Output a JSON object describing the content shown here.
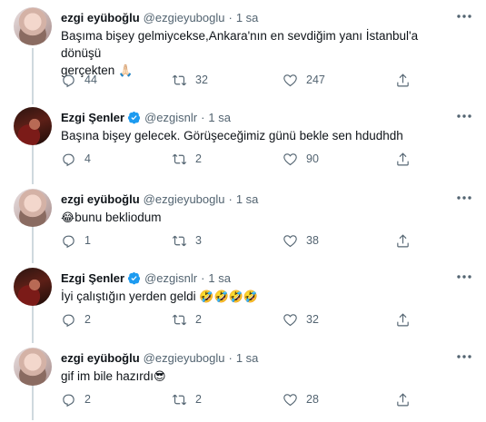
{
  "tweets": [
    {
      "name": "ezgi eyüboğlu",
      "handle": "@ezgieyuboglu",
      "separator": "·",
      "time": "1 sa",
      "verified": false,
      "avatar": "ezgi",
      "line1": "Başıma bişey gelmiycekse,Ankara'nın en sevdiğim yanı İstanbul'a dönüşü",
      "line2": "gerçekten",
      "emoji_after": "🙏🏻",
      "emoji_before": "",
      "replies": "44",
      "retweets": "32",
      "likes": "247"
    },
    {
      "name": "Ezgi Şenler",
      "handle": "@ezgisnlr",
      "separator": "·",
      "time": "1 sa",
      "verified": true,
      "avatar": "senler",
      "line1": "Başına bişey gelecek. Görüşeceğimiz günü bekle sen hdudhdh",
      "line2": "",
      "emoji_after": "",
      "emoji_before": "",
      "replies": "4",
      "retweets": "2",
      "likes": "90"
    },
    {
      "name": "ezgi eyüboğlu",
      "handle": "@ezgieyuboglu",
      "separator": "·",
      "time": "1 sa",
      "verified": false,
      "avatar": "ezgi",
      "line1": "bunu bekliodum",
      "line2": "",
      "emoji_after": "",
      "emoji_before": "😂",
      "replies": "1",
      "retweets": "3",
      "likes": "38"
    },
    {
      "name": "Ezgi Şenler",
      "handle": "@ezgisnlr",
      "separator": "·",
      "time": "1 sa",
      "verified": true,
      "avatar": "senler",
      "line1": "İyi çalıştığın yerden geldi",
      "line2": "",
      "emoji_after": "🤣🤣🤣🤣",
      "emoji_before": "",
      "replies": "2",
      "retweets": "2",
      "likes": "32"
    },
    {
      "name": "ezgi eyüboğlu",
      "handle": "@ezgieyuboglu",
      "separator": "·",
      "time": "1 sa",
      "verified": false,
      "avatar": "ezgi",
      "line1": "gif im bile hazırdı",
      "line2": "",
      "emoji_after": "😎",
      "emoji_before": "",
      "replies": "2",
      "retweets": "2",
      "likes": "28"
    }
  ],
  "icons": {
    "reply": "reply-icon",
    "retweet": "retweet-icon",
    "like": "like-icon",
    "share": "share-icon",
    "more": "more-icon",
    "verified": "verified-badge-icon"
  },
  "colors": {
    "text": "#0f1419",
    "secondary": "#536471",
    "verified": "#1d9bf0",
    "thread_line": "#cfd9de"
  }
}
